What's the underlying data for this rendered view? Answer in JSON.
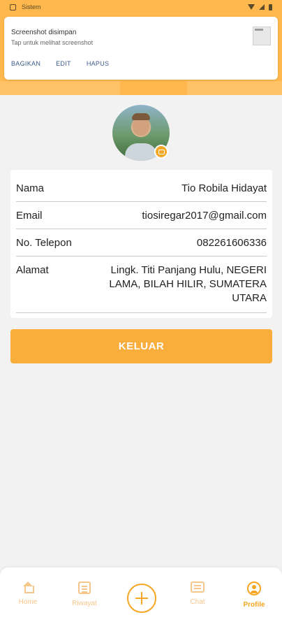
{
  "status_bar": {
    "app_label": "Sistem"
  },
  "notification": {
    "title": "Screenshot disimpan",
    "subtitle": "Tap untuk melihat screenshot",
    "actions": [
      "BAGIKAN",
      "EDIT",
      "HAPUS"
    ]
  },
  "profile": {
    "fields": [
      {
        "label": "Nama",
        "value": "Tio Robila Hidayat"
      },
      {
        "label": "Email",
        "value": "tiosiregar2017@gmail.com"
      },
      {
        "label": "No. Telepon",
        "value": "082261606336"
      },
      {
        "label": "Alamat",
        "value": "Lingk. Titi Panjang Hulu, NEGERI LAMA, BILAH HILIR, SUMATERA UTARA"
      }
    ],
    "logout_label": "KELUAR"
  },
  "bottom_nav": {
    "items": [
      {
        "label": "Home",
        "icon": "home-icon",
        "active": false
      },
      {
        "label": "Riwayat",
        "icon": "calendar-icon",
        "active": false
      },
      {
        "label": "Chat",
        "icon": "chat-icon",
        "active": false
      },
      {
        "label": "Profile",
        "icon": "profile-icon",
        "active": true
      }
    ],
    "fab_icon": "plus-icon"
  },
  "colors": {
    "accent": "#f5a623",
    "header": "#ffb84d",
    "background": "#f2f2f2"
  }
}
